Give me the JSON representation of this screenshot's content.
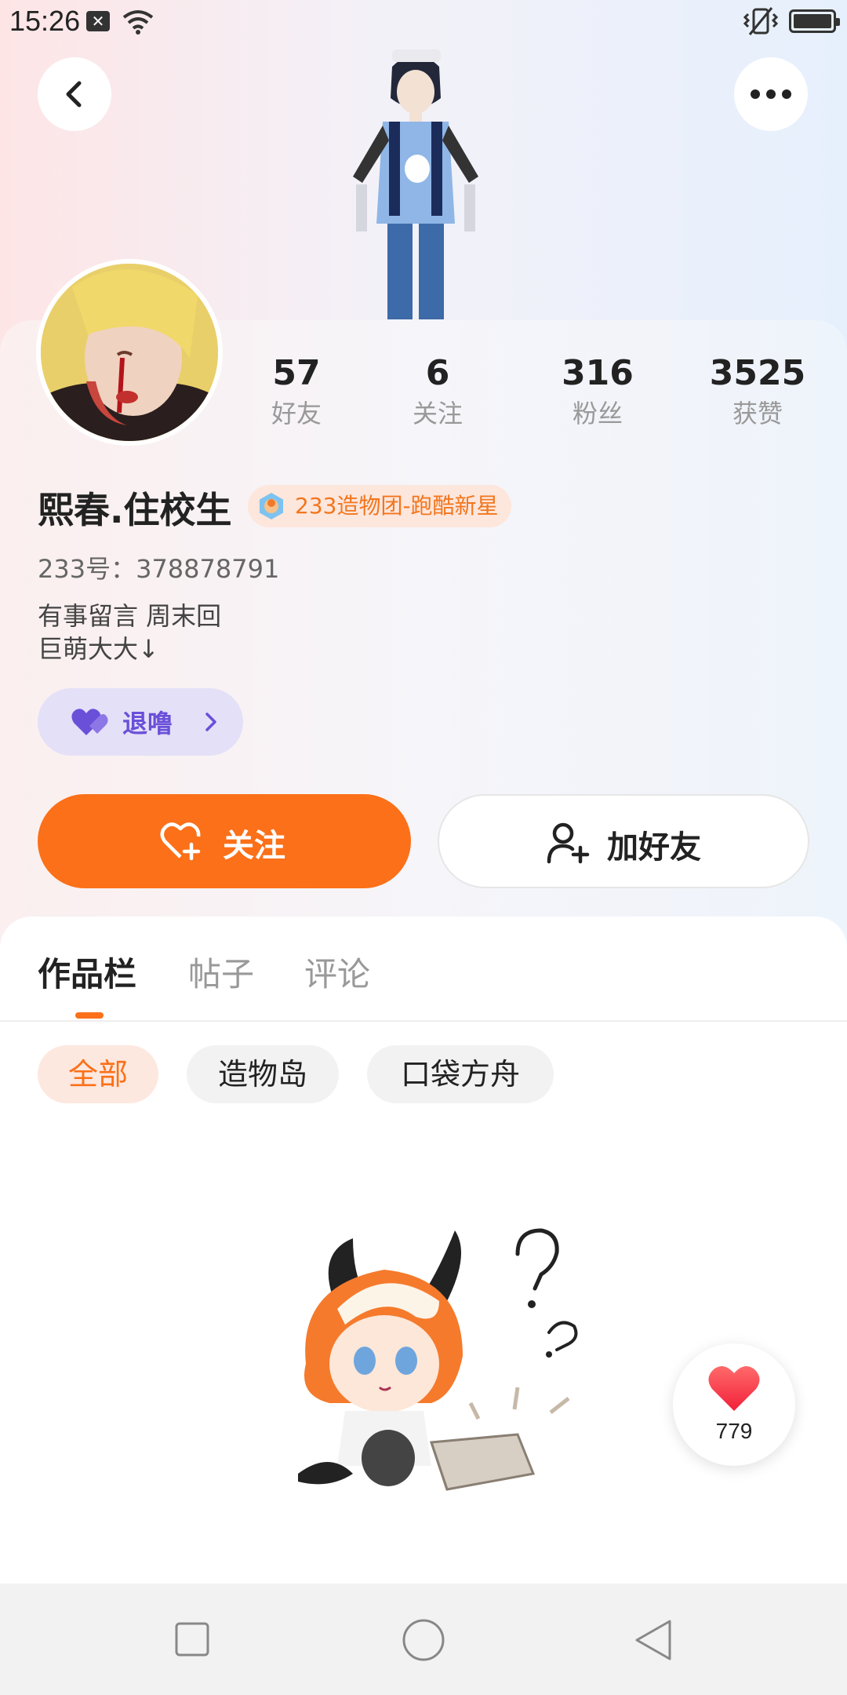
{
  "status_bar": {
    "time": "15:26"
  },
  "profile": {
    "stats": [
      {
        "num": "57",
        "label": "好友"
      },
      {
        "num": "6",
        "label": "关注"
      },
      {
        "num": "316",
        "label": "粉丝"
      },
      {
        "num": "3525",
        "label": "获赞"
      }
    ],
    "name": "熙春.住校生",
    "badge": "233造物团-跑酷新星",
    "uid": "233号：378878791",
    "bio_line1": "有事留言 周末回",
    "bio_line2": "巨萌大大↓",
    "tag_label": "退噜"
  },
  "actions": {
    "follow": "关注",
    "add_friend": "加好友"
  },
  "tabs": [
    {
      "label": "作品栏",
      "active": true
    },
    {
      "label": "帖子",
      "active": false
    },
    {
      "label": "评论",
      "active": false
    }
  ],
  "filters": [
    {
      "label": "全部",
      "active": true
    },
    {
      "label": "造物岛",
      "active": false
    },
    {
      "label": "口袋方舟",
      "active": false
    }
  ],
  "like_float": {
    "count": "779"
  },
  "colors": {
    "accent": "#fb7018",
    "tag": "#6a4fd9"
  }
}
